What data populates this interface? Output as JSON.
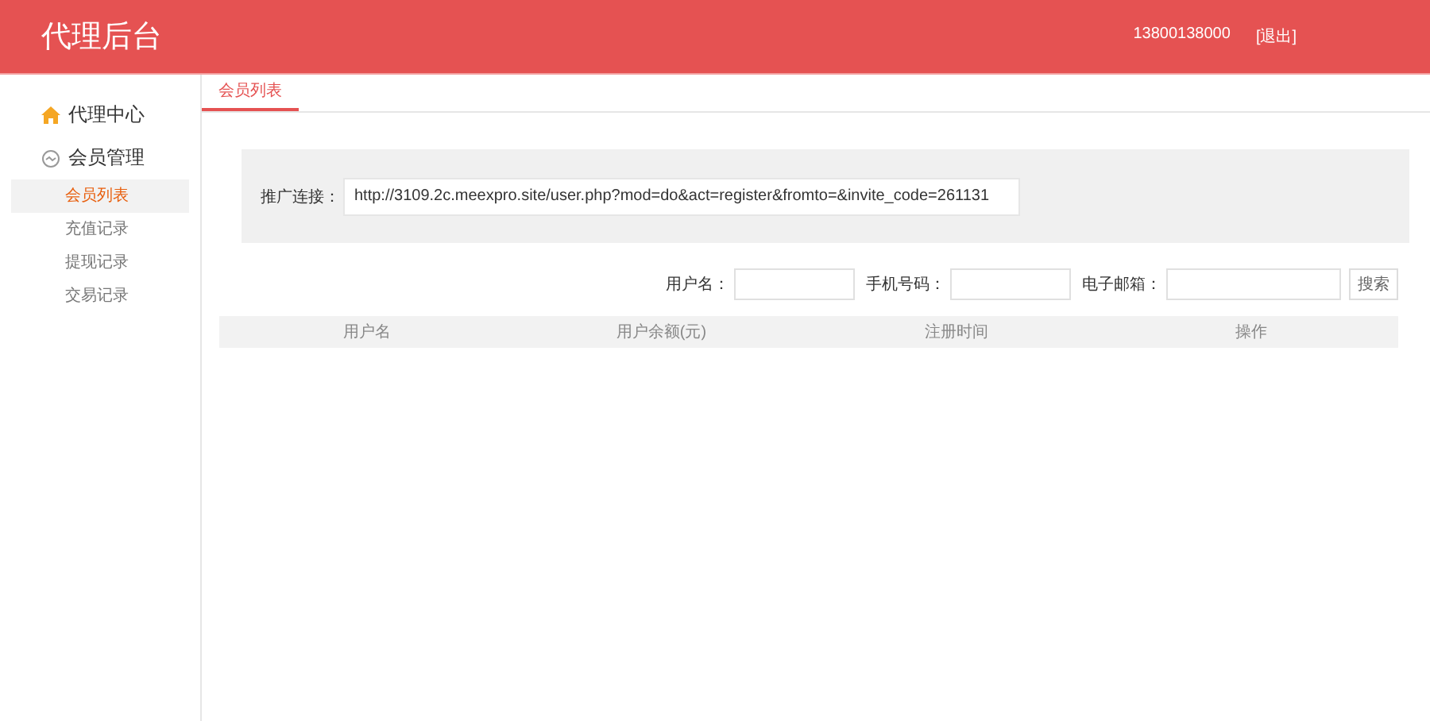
{
  "header": {
    "title": "代理后台",
    "user": "13800138000",
    "logout": "[退出]"
  },
  "sidebar": {
    "groups": [
      {
        "label": "代理中心",
        "kind": "home"
      },
      {
        "label": "会员管理",
        "kind": "sync",
        "children": [
          {
            "label": "会员列表",
            "selected": true
          },
          {
            "label": "充值记录",
            "selected": false
          },
          {
            "label": "提现记录",
            "selected": false
          },
          {
            "label": "交易记录",
            "selected": false
          }
        ]
      }
    ]
  },
  "tabs": [
    {
      "label": "会员列表",
      "selected": true
    }
  ],
  "promo": {
    "label": "推广连接：",
    "value": "http://3109.2c.meexpro.site/user.php?mod=do&act=register&fromto=&invite_code=261131"
  },
  "search": {
    "fields": [
      {
        "label": "用户名："
      },
      {
        "label": "手机号码："
      },
      {
        "label": "电子邮箱："
      }
    ],
    "button": "搜索"
  },
  "table": {
    "columns": [
      "用户名",
      "用户余额(元)",
      "注册时间",
      "操作"
    ]
  }
}
